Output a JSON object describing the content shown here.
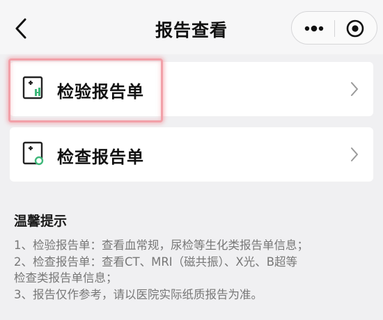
{
  "nav": {
    "title": "报告查看",
    "back_icon": "chevron-left-icon",
    "more_icon": "more-dots-icon",
    "close_icon": "target-close-icon"
  },
  "cards": [
    {
      "label": "检验报告单",
      "icon": "lab-report-icon",
      "highlighted": true
    },
    {
      "label": "检查报告单",
      "icon": "exam-report-icon",
      "highlighted": false
    }
  ],
  "tips": {
    "title": "温馨提示",
    "lines": [
      "1、检验报告单：查看血常规，尿检等生化类报告单信息；",
      "2、检查报告单：查看CT、MRI（磁共振）、X光、B超等",
      "检查类报告单信息；",
      "3、报告仅作参考，请以医院实际纸质报告为准。"
    ]
  },
  "colors": {
    "background": "#f0f0f2",
    "card": "#ffffff",
    "highlight": "#f2a0a8",
    "accent_green": "#3fb87a"
  }
}
